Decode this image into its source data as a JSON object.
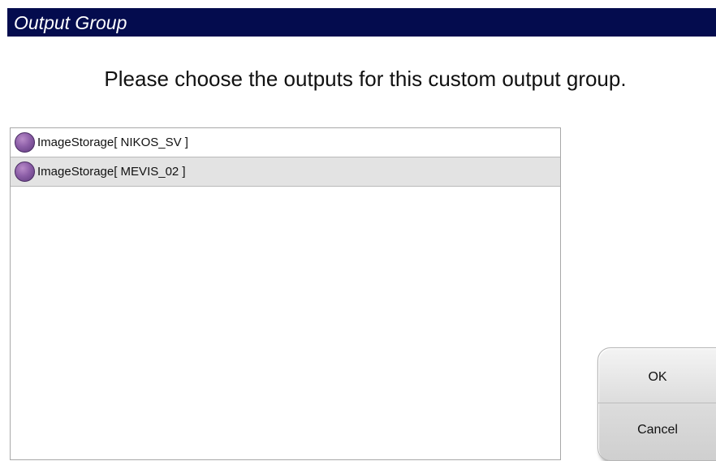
{
  "dialog": {
    "title": "Output Group",
    "instruction": "Please choose the outputs for this custom output group."
  },
  "outputs": [
    {
      "label": "ImageStorage[ NIKOS_SV ]",
      "icon": "purple-circle-icon"
    },
    {
      "label": "ImageStorage[ MEVIS_02 ]",
      "icon": "purple-circle-icon"
    }
  ],
  "buttons": {
    "ok_label": "OK",
    "cancel_label": "Cancel"
  },
  "colors": {
    "title_bar": "#040c4e",
    "bullet": "#8d5fa8",
    "alt_row": "#e3e3e3"
  }
}
